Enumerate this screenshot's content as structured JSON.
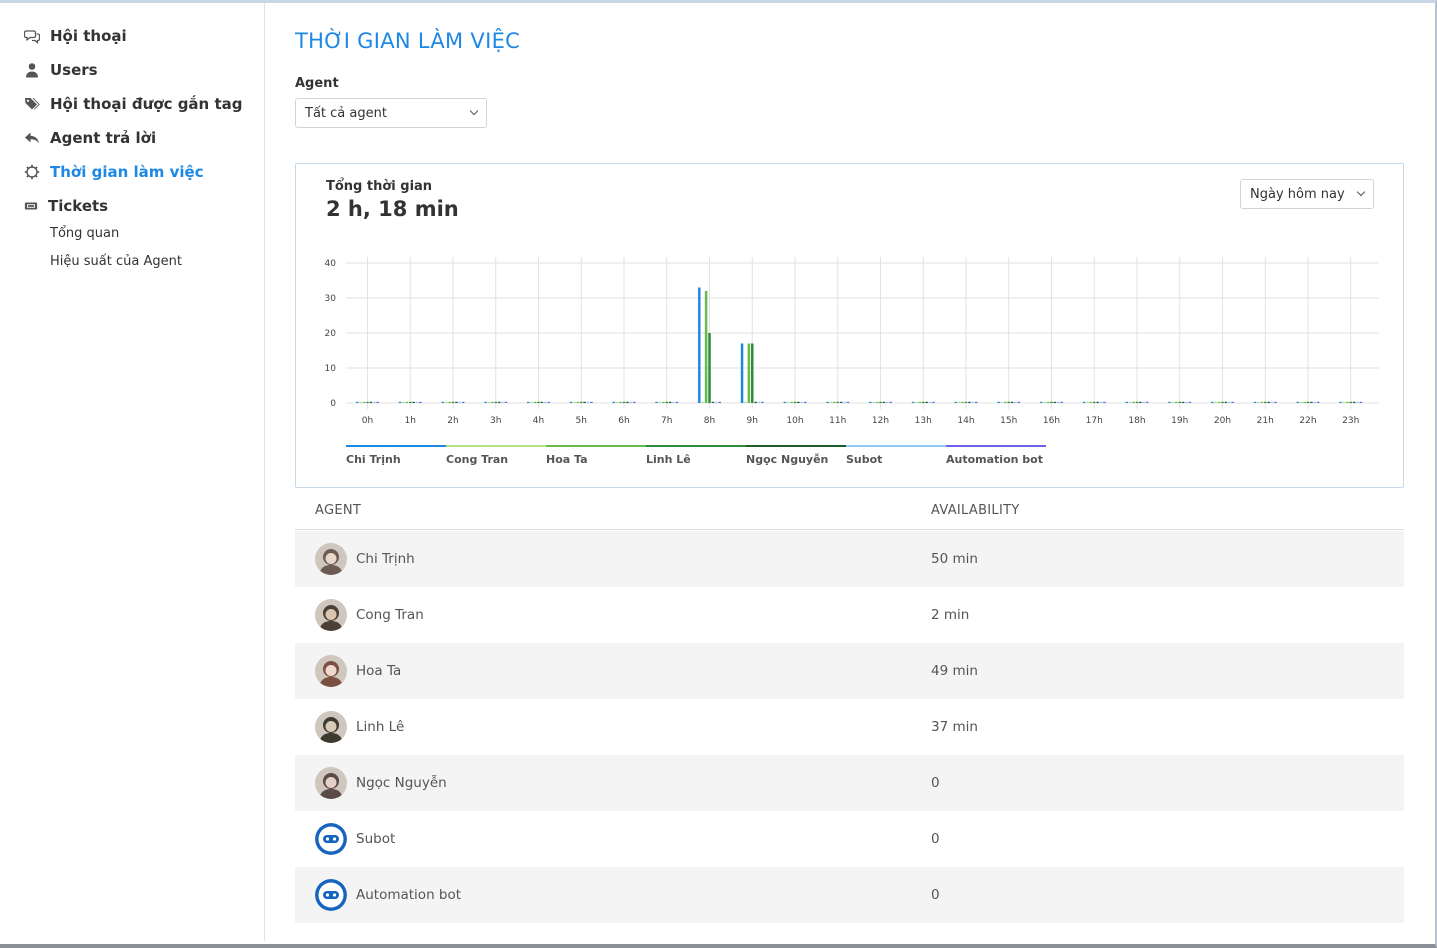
{
  "sidebar": {
    "items": [
      {
        "label": "Hội thoại",
        "icon": "chat-bubbles-icon"
      },
      {
        "label": "Users",
        "icon": "user-icon"
      },
      {
        "label": "Hội thoại được gắn tag",
        "icon": "tags-icon"
      },
      {
        "label": "Agent trả lời",
        "icon": "reply-icon"
      },
      {
        "label": "Thời gian làm việc",
        "icon": "clock-gear-icon",
        "active": true
      },
      {
        "label": "Tickets",
        "icon": "ticket-icon"
      }
    ],
    "sub_items": [
      {
        "label": "Tổng quan"
      },
      {
        "label": "Hiệu suất của Agent"
      }
    ]
  },
  "page": {
    "title": "THỜI GIAN LÀM VIỆC",
    "agent_label": "Agent",
    "agent_select": "Tất cả agent"
  },
  "card": {
    "total_label": "Tổng thời gian",
    "total_value": "2 h, 18 min",
    "range_select": "Ngày hôm nay"
  },
  "colors": {
    "accent": "#1e88e5",
    "row_alt": "#f4f4f4"
  },
  "chart_data": {
    "type": "bar",
    "categories": [
      "0h",
      "1h",
      "2h",
      "3h",
      "4h",
      "5h",
      "6h",
      "7h",
      "8h",
      "9h",
      "10h",
      "11h",
      "12h",
      "13h",
      "14h",
      "15h",
      "16h",
      "17h",
      "18h",
      "19h",
      "20h",
      "21h",
      "22h",
      "23h"
    ],
    "ylim": [
      0,
      40
    ],
    "yticks": [
      0,
      10,
      20,
      30,
      40
    ],
    "grid": true,
    "legend_position": "bottom",
    "series": [
      {
        "name": "Chi Trịnh",
        "color": "#1e88e5",
        "values": [
          0,
          0,
          0,
          0,
          0,
          0,
          0,
          0,
          33,
          17,
          0,
          0,
          0,
          0,
          0,
          0,
          0,
          0,
          0,
          0,
          0,
          0,
          0,
          0
        ]
      },
      {
        "name": "Cong Tran",
        "color": "#b5e08a",
        "values": [
          0,
          0,
          0,
          0,
          0,
          0,
          0,
          0,
          0,
          0,
          0,
          0,
          0,
          0,
          0,
          0,
          0,
          0,
          0,
          0,
          0,
          0,
          0,
          0
        ]
      },
      {
        "name": "Hoa Ta",
        "color": "#66bb4a",
        "values": [
          0,
          0,
          0,
          0,
          0,
          0,
          0,
          0,
          32,
          17,
          0,
          0,
          0,
          0,
          0,
          0,
          0,
          0,
          0,
          0,
          0,
          0,
          0,
          0
        ]
      },
      {
        "name": "Linh Lê",
        "color": "#2e8b3a",
        "values": [
          0,
          0,
          0,
          0,
          0,
          0,
          0,
          0,
          20,
          17,
          0,
          0,
          0,
          0,
          0,
          0,
          0,
          0,
          0,
          0,
          0,
          0,
          0,
          0
        ]
      },
      {
        "name": "Ngọc Nguyễn",
        "color": "#1f5c28",
        "values": [
          0,
          0,
          0,
          0,
          0,
          0,
          0,
          0,
          0,
          0,
          0,
          0,
          0,
          0,
          0,
          0,
          0,
          0,
          0,
          0,
          0,
          0,
          0,
          0
        ]
      },
      {
        "name": "Subot",
        "color": "#90caf9",
        "values": [
          0,
          0,
          0,
          0,
          0,
          0,
          0,
          0,
          0,
          0,
          0,
          0,
          0,
          0,
          0,
          0,
          0,
          0,
          0,
          0,
          0,
          0,
          0,
          0
        ]
      },
      {
        "name": "Automation bot",
        "color": "#6f63e8",
        "values": [
          0,
          0,
          0,
          0,
          0,
          0,
          0,
          0,
          0,
          0,
          0,
          0,
          0,
          0,
          0,
          0,
          0,
          0,
          0,
          0,
          0,
          0,
          0,
          0
        ]
      }
    ]
  },
  "table": {
    "headers": {
      "agent": "AGENT",
      "availability": "AVAILABILITY"
    },
    "rows": [
      {
        "name": "Chi Trịnh",
        "availability": "50 min",
        "avatar": "photo"
      },
      {
        "name": "Cong Tran",
        "availability": "2 min",
        "avatar": "photo"
      },
      {
        "name": "Hoa Ta",
        "availability": "49 min",
        "avatar": "photo"
      },
      {
        "name": "Linh Lê",
        "availability": "37 min",
        "avatar": "photo"
      },
      {
        "name": "Ngọc Nguyễn",
        "availability": "0",
        "avatar": "photo"
      },
      {
        "name": "Subot",
        "availability": "0",
        "avatar": "bot"
      },
      {
        "name": "Automation bot",
        "availability": "0",
        "avatar": "bot"
      }
    ]
  }
}
